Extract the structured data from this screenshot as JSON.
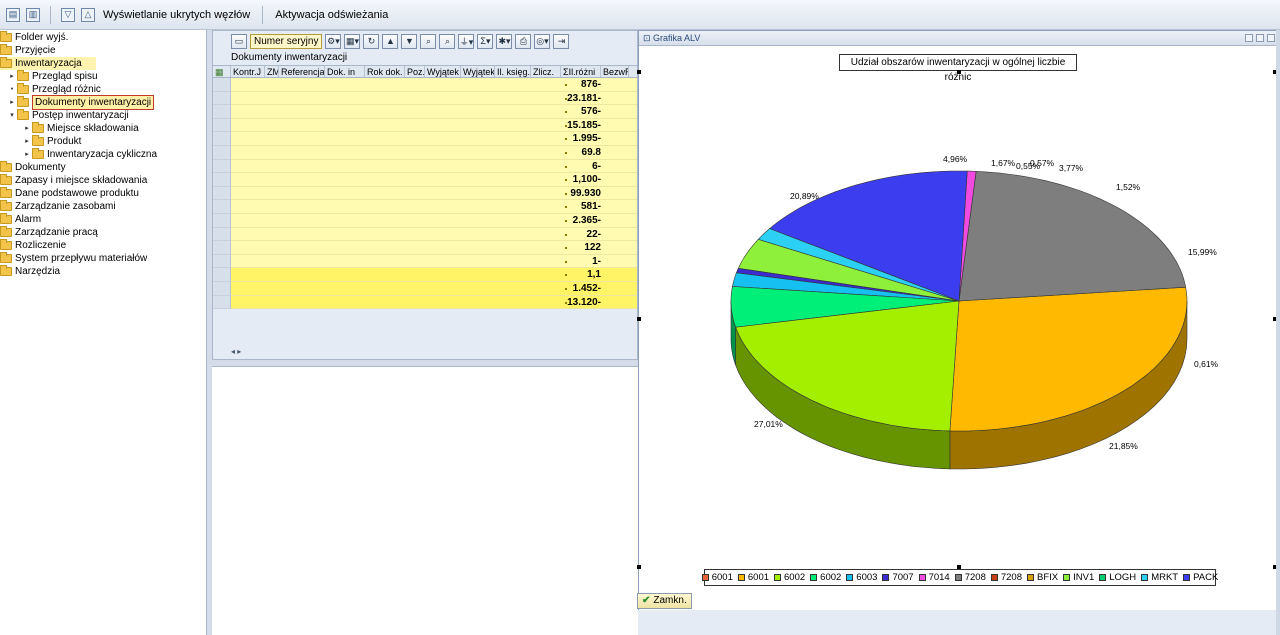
{
  "toolbar": {
    "show_hidden_nodes": "Wyświetlanie ukrytych węzłów",
    "activate_refresh": "Aktywacja odświeżania"
  },
  "tree": [
    {
      "label": "Folder wyjś.",
      "level": 0,
      "arrow": ""
    },
    {
      "label": "Przyjęcie",
      "level": 0,
      "arrow": ""
    },
    {
      "label": "Inwentaryzacja",
      "level": 0,
      "arrow": "",
      "state": "selected"
    },
    {
      "label": "Przegląd spisu",
      "level": 1,
      "arrow": "▸"
    },
    {
      "label": "Przegląd różnic",
      "level": 1,
      "arrow": "•"
    },
    {
      "label": "Dokumenty inwentaryzacji",
      "level": 1,
      "arrow": "▸",
      "state": "focused"
    },
    {
      "label": "Postęp inwentaryzacji",
      "level": 1,
      "arrow": "▾"
    },
    {
      "label": "Miejsce składowania",
      "level": 2,
      "arrow": "▸"
    },
    {
      "label": "Produkt",
      "level": 2,
      "arrow": "▸"
    },
    {
      "label": "Inwentaryzacja cykliczna",
      "level": 2,
      "arrow": "▸"
    },
    {
      "label": "Dokumenty",
      "level": 0,
      "arrow": ""
    },
    {
      "label": "Zapasy i miejsce składowania",
      "level": 0,
      "arrow": ""
    },
    {
      "label": "Dane podstawowe produktu",
      "level": 0,
      "arrow": ""
    },
    {
      "label": "Zarządzanie zasobami",
      "level": 0,
      "arrow": ""
    },
    {
      "label": "Alarm",
      "level": 0,
      "arrow": ""
    },
    {
      "label": "Zarządzanie pracą",
      "level": 0,
      "arrow": ""
    },
    {
      "label": "Rozliczenie",
      "level": 0,
      "arrow": ""
    },
    {
      "label": "System przepływu materiałów",
      "level": 0,
      "arrow": ""
    },
    {
      "label": "Narzędzia",
      "level": 0,
      "arrow": ""
    }
  ],
  "grid": {
    "serial_button": "Numer seryjny",
    "title": "Dokumenty inwentaryzacji",
    "columns": [
      "Kontr.J",
      "ZM",
      "Referencja",
      "Dok. in",
      "Rok dok.",
      "Poz.",
      "Wyjątek",
      "Wyjątek",
      "Il. księg.",
      "Zlicz.",
      "ΣIl.różni",
      "BezwR"
    ],
    "values": [
      "876-",
      "23.181-",
      "576-",
      "15.185-",
      "1.995-",
      "69.8",
      "6-",
      "1,100-",
      "99.930",
      "581-",
      "2.365-",
      "22-",
      "122",
      "1-",
      "1,1",
      "1.452-",
      "13.120-"
    ]
  },
  "chart_window": {
    "title": "Grafika ALV",
    "close_button": "Zamkn."
  },
  "chart_data": {
    "type": "pie",
    "title": "Udział obszarów inwentaryzacji w ogólnej liczbie różnic",
    "slices": [
      {
        "label": "6001",
        "value": 0.0,
        "color": "#e8663a"
      },
      {
        "label": "6001",
        "value": 27.01,
        "color": "#ffb900"
      },
      {
        "label": "6002",
        "value": 20.89,
        "color": "#a4ee00"
      },
      {
        "label": "6002",
        "value": 4.96,
        "color": "#00ef78"
      },
      {
        "label": "6003",
        "value": 1.67,
        "color": "#16c1f2"
      },
      {
        "label": "7007",
        "value": 0.55,
        "color": "#3a2ccf"
      },
      {
        "label": "7014",
        "value": 0.61,
        "color": "#f04ae0"
      },
      {
        "label": "7208",
        "value": 21.85,
        "color": "#7e7e7e"
      },
      {
        "label": "7208",
        "value": 0.0,
        "color": "#c8401a"
      },
      {
        "label": "BFIX",
        "value": 0.0,
        "color": "#d8a000"
      },
      {
        "label": "INV1",
        "value": 3.77,
        "color": "#8ef03a"
      },
      {
        "label": "LOGH",
        "value": 0.0,
        "color": "#00d070"
      },
      {
        "label": "MRKT",
        "value": 1.52,
        "color": "#2dd0f5"
      },
      {
        "label": "PACK",
        "value": 15.99,
        "color": "#3d3df0"
      }
    ],
    "value_labels": [
      "27,01%",
      "21,85%",
      "0,61%",
      "15,99%",
      "1,52%",
      "3,77%",
      "0,55%",
      "0,57%",
      "1,67%",
      "4,96%",
      "20,89%"
    ],
    "legend": [
      "6001",
      "6001",
      "6002",
      "6002",
      "6003",
      "7007",
      "7014",
      "7208",
      "7208",
      "BFIX",
      "INV1",
      "LOGH",
      "MRKT",
      "PACK"
    ],
    "legend_colors": [
      "#e8663a",
      "#ffb900",
      "#a4ee00",
      "#00ef78",
      "#16c1f2",
      "#3a2ccf",
      "#f04ae0",
      "#7e7e7e",
      "#c8401a",
      "#d8a000",
      "#8ef03a",
      "#00d070",
      "#2dd0f5",
      "#3d3df0"
    ],
    "legend_position": "bottom"
  }
}
